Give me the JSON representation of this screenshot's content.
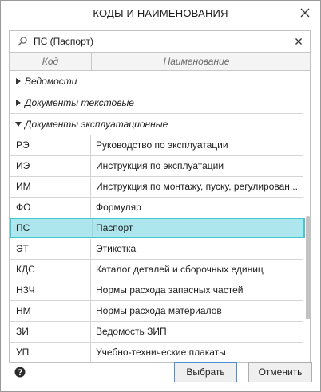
{
  "dialog": {
    "title": "КОДЫ И НАИМЕНОВАНИЯ"
  },
  "search": {
    "value": "ПС (Паспорт)",
    "placeholder": ""
  },
  "columns": {
    "code": "Код",
    "name": "Наименование"
  },
  "groups": [
    {
      "label": "Ведомости",
      "expanded": false
    },
    {
      "label": "Документы текстовые",
      "expanded": false
    },
    {
      "label": "Документы эксплуатационные",
      "expanded": true
    }
  ],
  "rows": [
    {
      "code": "РЭ",
      "name": "Руководство по эксплуатации"
    },
    {
      "code": "ИЭ",
      "name": "Инструкция по эксплуатации"
    },
    {
      "code": "ИМ",
      "name": "Инструкция по монтажу, пуску, регулирован..."
    },
    {
      "code": "ФО",
      "name": "Формуляр"
    },
    {
      "code": "ПС",
      "name": "Паспорт",
      "selected": true
    },
    {
      "code": "ЭТ",
      "name": "Этикетка"
    },
    {
      "code": "КДС",
      "name": "Каталог деталей и сборочных единиц"
    },
    {
      "code": "НЗЧ",
      "name": "Нормы расхода запасных частей"
    },
    {
      "code": "НМ",
      "name": "Нормы расхода материалов"
    },
    {
      "code": "ЗИ",
      "name": "Ведомость ЗИП"
    },
    {
      "code": "УП",
      "name": "Учебно-технические плакаты"
    }
  ],
  "buttons": {
    "select": "Выбрать",
    "cancel": "Отменить"
  },
  "colors": {
    "selected_bg": "#aee6ee",
    "selected_border": "#3cc6d6",
    "primary_border": "#4a90d9"
  }
}
